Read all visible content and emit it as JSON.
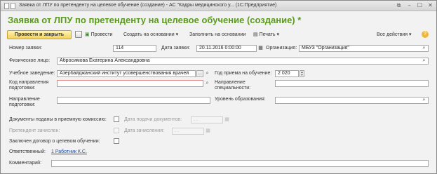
{
  "window": {
    "title": "Заявка от ЛПУ по претенденту на целевое обучение (создание) - АС \"Кадры медицинского у... (1С:Предприятие)",
    "controls": {
      "minimize": "–",
      "maximize": "☐",
      "close": "✕",
      "extra": "⧉"
    }
  },
  "form": {
    "title": "Заявка от ЛПУ по претенденту на целевое обучение (создание) *"
  },
  "toolbar": {
    "post_and_close": "Провести и закрыть",
    "post": "Провести",
    "create_based_on": "Создать на основании",
    "fill_based_on": "Заполнить на основании",
    "print": "Печать",
    "all_actions": "Все действия",
    "help": "?"
  },
  "fields": {
    "request_number": {
      "label": "Номер заявки:",
      "value": "114"
    },
    "request_date": {
      "label": "Дата заявки:",
      "value": "20.11.2016  0:00:00"
    },
    "organization": {
      "label": "Организация:",
      "value": "МБУЗ \"Организация\""
    },
    "person": {
      "label": "Физическое лицо:",
      "value": "Абросимова Екатерина Александровна"
    },
    "institution": {
      "label": "Учебное заведение:",
      "value": "Азербайджанский институт усовершенствования врачей"
    },
    "admission_year": {
      "label": "Год приема на обучение:",
      "value": "2 020"
    },
    "training_code": {
      "label": "Код направления подготовки:",
      "value": ""
    },
    "specialty_direction": {
      "label": "Направление специальности:",
      "value": ""
    },
    "training_direction": {
      "label": "Направление подготовки:",
      "value": ""
    },
    "education_level": {
      "label": "Уровень образования:",
      "value": ""
    },
    "docs_submitted": {
      "label": "Документы поданы в приемную комиссию:"
    },
    "docs_date": {
      "label": "Дата подачи документов:",
      "value": " .  .    "
    },
    "enrolled": {
      "label": "Претендент зачислен:"
    },
    "enroll_date": {
      "label": "Дата зачисления:",
      "value": " .  .    "
    },
    "contract": {
      "label": "Заключен договор о целевом обучении:"
    },
    "responsible": {
      "label": "Ответственный:",
      "value": "1 Работник К.С."
    },
    "comment": {
      "label": "Комментарий:",
      "value": ""
    }
  },
  "icons": {
    "search": "⌕",
    "dots": "...",
    "calendar": "▦",
    "dropdown": "▾"
  }
}
